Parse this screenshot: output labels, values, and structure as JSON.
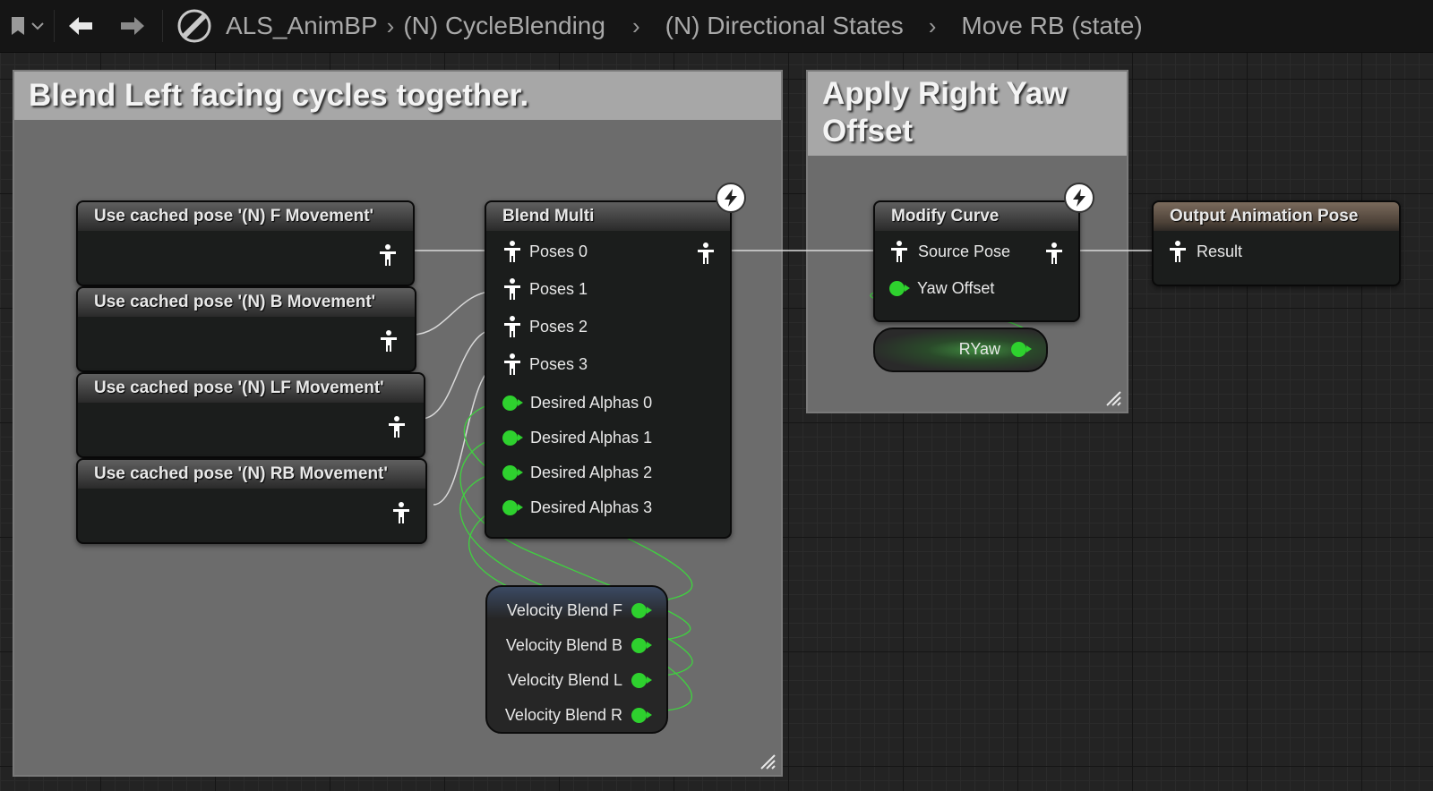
{
  "breadcrumb": {
    "root": "ALS_AnimBP",
    "items": [
      "(N) CycleBlending",
      "(N) Directional States",
      "Move RB (state)"
    ]
  },
  "comments": {
    "left_title": "Blend Left facing cycles together.",
    "right_title": "Apply Right Yaw Offset"
  },
  "cached_poses": [
    "Use cached pose '(N) F Movement'",
    "Use cached pose '(N) B Movement'",
    "Use cached pose '(N) LF Movement'",
    "Use cached pose '(N) RB Movement'"
  ],
  "blend_multi": {
    "title": "Blend Multi",
    "pose_pins": [
      "Poses 0",
      "Poses 1",
      "Poses 2",
      "Poses 3"
    ],
    "alpha_pins": [
      "Desired Alphas 0",
      "Desired Alphas 1",
      "Desired Alphas 2",
      "Desired Alphas 3"
    ]
  },
  "velocity_node": {
    "pins": [
      "Velocity Blend F",
      "Velocity Blend B",
      "Velocity Blend L",
      "Velocity Blend R"
    ]
  },
  "modify_curve": {
    "title": "Modify Curve",
    "source_pose": "Source Pose",
    "yaw_offset": "Yaw Offset"
  },
  "ryaw_node": {
    "label": "RYaw"
  },
  "output_node": {
    "title": "Output Animation Pose",
    "result": "Result"
  },
  "colors": {
    "float_pin": "#2ed12e",
    "wire_pose": "#d9d9d9",
    "comment_bg": "#6c6c6c"
  }
}
